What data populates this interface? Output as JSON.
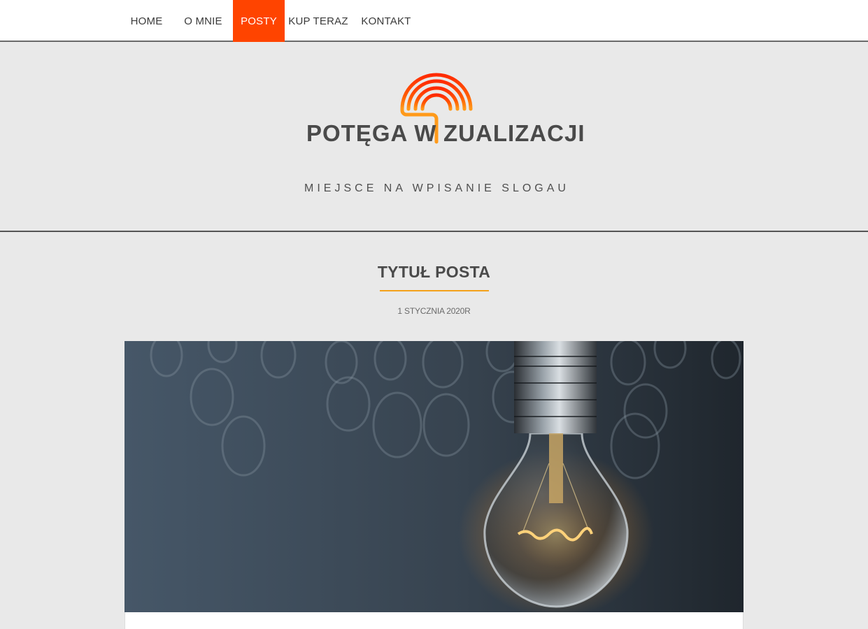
{
  "nav": {
    "items": [
      {
        "label": "HOME",
        "active": false
      },
      {
        "label": "O MNIE",
        "active": false
      },
      {
        "label": "POSTY",
        "active": true
      },
      {
        "label": "KUP TERAZ",
        "active": false
      },
      {
        "label": "KONTAKT",
        "active": false
      }
    ]
  },
  "header": {
    "logo_text_left": "POTĘGA W",
    "logo_text_right": "ZUALIZACJI",
    "logo_icon": "rainbow-question-mark-icon",
    "slogan": "MIEJSCE NA WPISANIE SLOGAU"
  },
  "post": {
    "title": "TYTUŁ POSTA",
    "date": "1 STYCZNIA 2020R",
    "image": "glowing-light-bulb-image"
  },
  "colors": {
    "accent": "#ff4400",
    "title_rule": "#f4a11a",
    "background": "#e9e9e9"
  }
}
